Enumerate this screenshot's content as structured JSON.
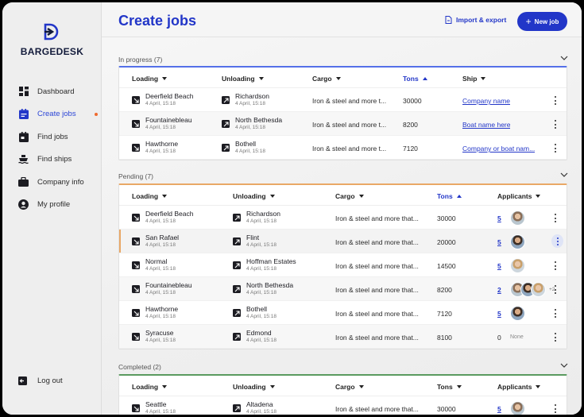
{
  "sidebar": {
    "brand": "BARGEDESK",
    "items": [
      {
        "label": "Dashboard",
        "icon": "dashboard-icon",
        "active": false
      },
      {
        "label": "Create jobs",
        "icon": "create-jobs-icon",
        "active": true
      },
      {
        "label": "Find jobs",
        "icon": "find-jobs-icon",
        "active": false
      },
      {
        "label": "Find ships",
        "icon": "ship-icon",
        "active": false
      },
      {
        "label": "Company info",
        "icon": "briefcase-icon",
        "active": false
      },
      {
        "label": "My profile",
        "icon": "profile-icon",
        "active": false
      }
    ],
    "logout": "Log out"
  },
  "header": {
    "title": "Create jobs",
    "import_label": "Import & export",
    "new_job_label": "New job"
  },
  "colors": {
    "accent": "#2236c8",
    "in_progress": "#5470e8",
    "pending": "#e9a866",
    "completed": "#5a9a5f",
    "notification": "#ef6a2e"
  },
  "in_progress": {
    "heading": "In progress (7)",
    "columns": {
      "loading": "Loading",
      "unloading": "Unloading",
      "cargo": "Cargo",
      "tons": "Tons",
      "ship": "Ship"
    },
    "rows": [
      {
        "loading": "Deerfield Beach",
        "loading_date": "4 April, 15:18",
        "unloading": "Richardson",
        "unloading_date": "4 April, 15:18",
        "cargo": "Iron & steel and more t...",
        "tons": "30000",
        "ship": "Company name"
      },
      {
        "loading": "Fountainebleau",
        "loading_date": "4 April, 15:18",
        "unloading": "North Bethesda",
        "unloading_date": "4 April, 15:18",
        "cargo": "Iron & steel and more t...",
        "tons": "8200",
        "ship": "Boat name here"
      },
      {
        "loading": "Hawthorne",
        "loading_date": "4 April, 15:18",
        "unloading": "Bothell",
        "unloading_date": "4 April, 15:18",
        "cargo": "Iron & steel and more t...",
        "tons": "7120",
        "ship": "Company or boat nam..."
      }
    ]
  },
  "pending": {
    "heading": "Pending (7)",
    "columns": {
      "loading": "Loading",
      "unloading": "Unloading",
      "cargo": "Cargo",
      "tons": "Tons",
      "applicants": "Applicants"
    },
    "rows": [
      {
        "loading": "Deerfield Beach",
        "loading_date": "4 April, 15:18",
        "unloading": "Richardson",
        "unloading_date": "4 April, 15:18",
        "cargo": "Iron & steel and more that...",
        "tons": "30000",
        "applicants": "5"
      },
      {
        "loading": "San Rafael",
        "loading_date": "4 April, 15:18",
        "unloading": "Flint",
        "unloading_date": "4 April, 15:18",
        "cargo": "Iron & steel and more that...",
        "tons": "20000",
        "applicants": "5"
      },
      {
        "loading": "Normal",
        "loading_date": "4 April, 15:18",
        "unloading": "Hoffman Estates",
        "unloading_date": "4 April, 15:18",
        "cargo": "Iron & steel and more that...",
        "tons": "14500",
        "applicants": "5"
      },
      {
        "loading": "Fountainebleau",
        "loading_date": "4 April, 15:18",
        "unloading": "North Bethesda",
        "unloading_date": "4 April, 15:18",
        "cargo": "Iron & steel and more that...",
        "tons": "8200",
        "applicants": "2",
        "more": "+2"
      },
      {
        "loading": "Hawthorne",
        "loading_date": "4 April, 15:18",
        "unloading": "Bothell",
        "unloading_date": "4 April, 15:18",
        "cargo": "Iron & steel and more that...",
        "tons": "7120",
        "applicants": "5"
      },
      {
        "loading": "Syracuse",
        "loading_date": "4 April, 15:18",
        "unloading": "Edmond",
        "unloading_date": "4 April, 15:18",
        "cargo": "Iron & steel and more that...",
        "tons": "8100",
        "applicants": "0",
        "none": "None"
      }
    ]
  },
  "completed": {
    "heading": "Completed (2)",
    "columns": {
      "loading": "Loading",
      "unloading": "Unloading",
      "cargo": "Cargo",
      "tons": "Tons",
      "applicants": "Applicants"
    },
    "rows": [
      {
        "loading": "Seattle",
        "loading_date": "4 April, 15:18",
        "unloading": "Altadena",
        "unloading_date": "4 April, 15:18",
        "cargo": "Iron & steel and more that...",
        "tons": "30000",
        "applicants": "5"
      }
    ]
  }
}
